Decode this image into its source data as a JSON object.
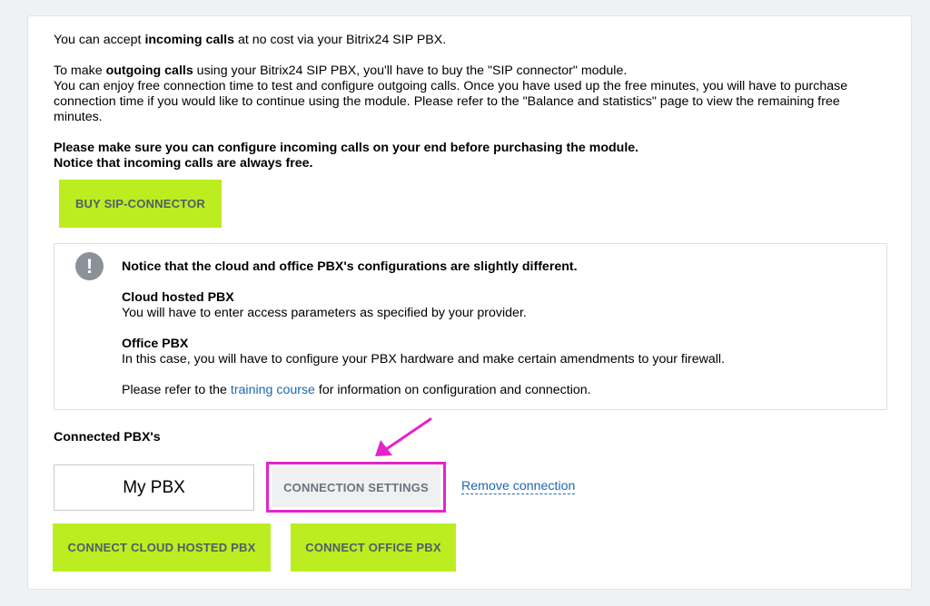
{
  "intro": {
    "line1_prefix": "You can accept ",
    "line1_bold": "incoming calls",
    "line1_suffix": " at no cost via your Bitrix24 SIP PBX.",
    "line2_prefix": "To make ",
    "line2_bold": "outgoing calls",
    "line2_suffix": " using your Bitrix24 SIP PBX, you'll have to buy the \"SIP connector\" module.",
    "line3": "You can enjoy free connection time to test and configure outgoing calls. Once you have used up the free minutes, you will have to purchase connection time if you would like to continue using the module. Please refer to the \"Balance and statistics\" page to view the remaining free minutes.",
    "warning1": "Please make sure you can configure incoming calls on your end before purchasing the module.",
    "warning2": "Notice that incoming calls are always free."
  },
  "buy_button": "BUY SIP-CONNECTOR",
  "notice": {
    "icon": "!",
    "title": "Notice that the cloud and office PBX's configurations are slightly different.",
    "cloud_title": "Cloud hosted PBX",
    "cloud_text": "You will have to enter access parameters as specified by your provider.",
    "office_title": "Office PBX",
    "office_text": "In this case, you will have to configure your PBX hardware and make certain amendments to your firewall.",
    "refer_prefix": "Please refer to the ",
    "refer_link": "training course",
    "refer_suffix": " for information on configuration and connection."
  },
  "connected": {
    "title": "Connected PBX's",
    "pbx_name": "My PBX",
    "settings_button": "CONNECTION SETTINGS",
    "remove_link": "Remove connection",
    "connect_cloud_button": "CONNECT CLOUD HOSTED PBX",
    "connect_office_button": "CONNECT OFFICE PBX"
  },
  "colors": {
    "accent_green": "#bbed21",
    "annotation_magenta": "#e524c8",
    "link_blue": "#2067b0"
  }
}
